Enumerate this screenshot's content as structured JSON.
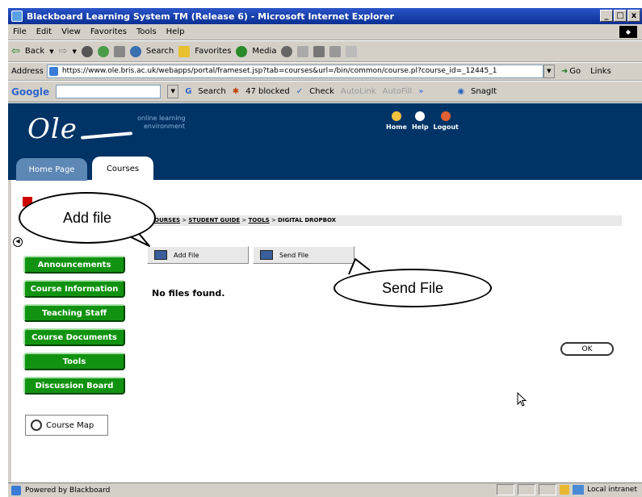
{
  "window": {
    "title": "Blackboard Learning System TM (Release 6) - Microsoft Internet Explorer",
    "controls": [
      "_",
      "□",
      "x"
    ]
  },
  "menu": [
    "File",
    "Edit",
    "View",
    "Favorites",
    "Tools",
    "Help"
  ],
  "toolbar": {
    "back": "Back",
    "search": "Search",
    "favorites": "Favorites",
    "media": "Media"
  },
  "address": {
    "label": "Address",
    "url": "https://www.ole.bris.ac.uk/webapps/portal/frameset.jsp?tab=courses&url=/bin/common/course.pl?course_id=_12445_1",
    "go": "Go",
    "links": "Links"
  },
  "googlebar": {
    "logo": "Google",
    "search": "Search",
    "blocked": "47 blocked",
    "check": "Check",
    "autolink": "AutoLink",
    "autofill": "AutoFill",
    "snagit": "SnagIt"
  },
  "header": {
    "logo": "Ole",
    "tagline_1": "online learning",
    "tagline_2": "environment",
    "links": [
      "Home",
      "Help",
      "Logout"
    ]
  },
  "tabs": {
    "home": "Home Page",
    "courses": "Courses"
  },
  "breadcrumb": {
    "items": [
      "COURSES",
      "STUDENT GUIDE",
      "TOOLS"
    ],
    "current": "DIGITAL DROPBOX",
    "separator": ">"
  },
  "nav": [
    "Announcements",
    "Course Information",
    "Teaching Staff",
    "Course Documents",
    "Tools",
    "Discussion Board"
  ],
  "course_map": "Course Map",
  "actions": {
    "add_file": "Add File",
    "send_file": "Send File"
  },
  "message": "No files found.",
  "ok": "OK",
  "callouts": {
    "add": "Add file",
    "send": "Send File"
  },
  "status": {
    "left": "Powered by Blackboard",
    "zone": "Local intranet"
  },
  "colors": {
    "header_bg": "#003366",
    "nav_green": "#119311",
    "tab_blue": "#5d87b5"
  }
}
